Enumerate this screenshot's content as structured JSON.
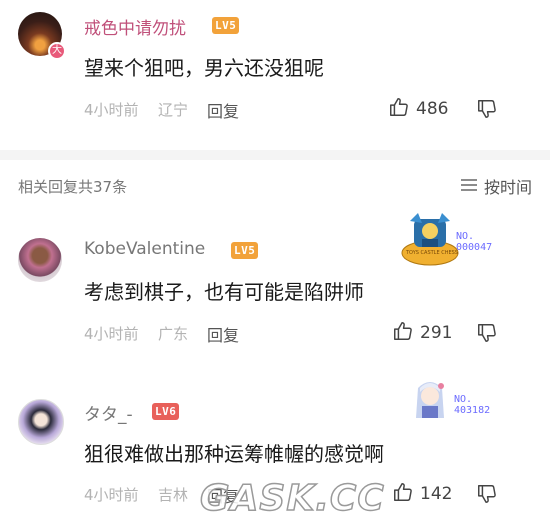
{
  "top_comment": {
    "username": "戒色中请勿扰",
    "level": "LV5",
    "text": "望来个狙吧，男六还没狙呢",
    "time": "4小时前",
    "location": "辽宁",
    "reply_label": "回复",
    "likes": "486",
    "avatar_badge": "大"
  },
  "section": {
    "title": "相关回复共37条",
    "sort_label": "按时间"
  },
  "replies": [
    {
      "username": "KobeValentine",
      "level": "LV5",
      "text": "考虑到棋子，也有可能是陷阱师",
      "time": "4小时前",
      "location": "广东",
      "reply_label": "回复",
      "likes": "291",
      "deco_no": "NO.",
      "deco_num": "000047",
      "deco_tag": "TOYS CASTLE CHESS"
    },
    {
      "username": "タタ_-",
      "level": "LV6",
      "text": "狙很难做出那种运筹帷幄的感觉啊",
      "time": "4小时前",
      "location": "吉林",
      "reply_label": "回复",
      "likes": "142",
      "deco_no": "NO.",
      "deco_num": "403182"
    }
  ],
  "colors": {
    "top_username": "#c0507a",
    "lv5": "#f2a23a",
    "lv6": "#e8605a",
    "meta": "#b3b3b3"
  },
  "watermark": "GASK.CC"
}
